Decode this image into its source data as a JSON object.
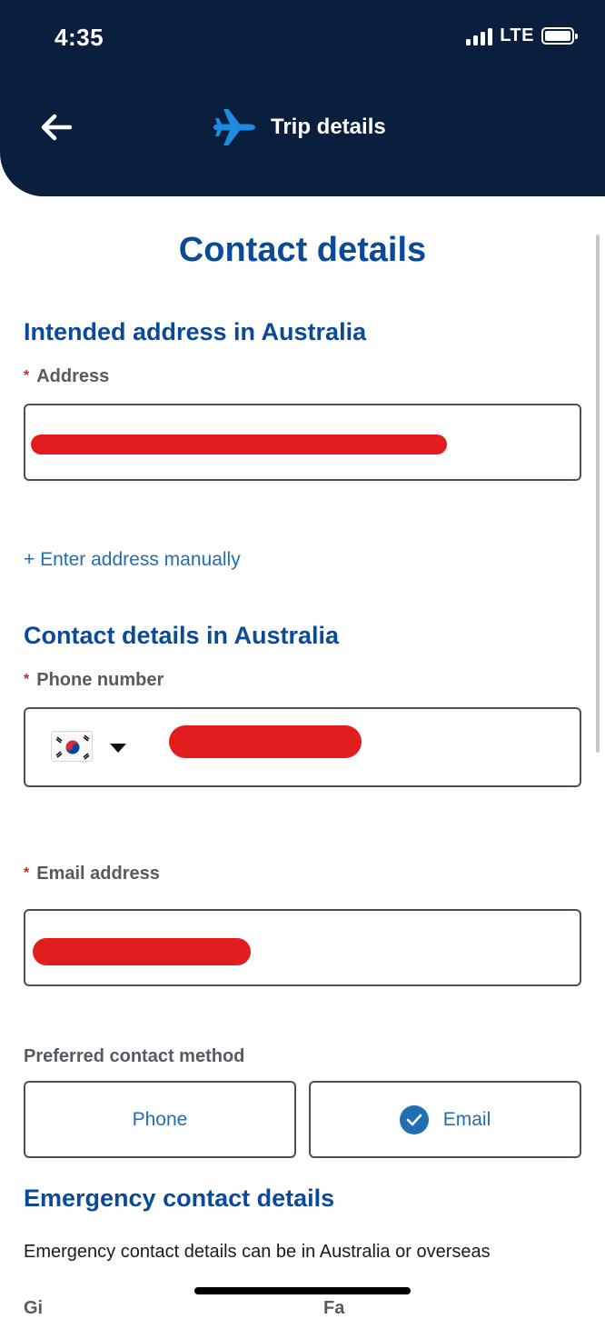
{
  "status_bar": {
    "time": "4:35",
    "network": "LTE"
  },
  "header": {
    "title": "Trip details",
    "back_icon": "arrow-left-icon",
    "plane_icon": "airplane-icon"
  },
  "page": {
    "title": "Contact details"
  },
  "address_section": {
    "heading": "Intended address in Australia",
    "address_label": "Address",
    "required_mark": "*",
    "manual_link": "+ Enter address manually"
  },
  "contact_section": {
    "heading": "Contact details in Australia",
    "phone_label": "Phone number",
    "email_label": "Email address",
    "preferred_label": "Preferred contact method",
    "options": [
      {
        "label": "Phone",
        "selected": false
      },
      {
        "label": "Email",
        "selected": true
      }
    ]
  },
  "emergency_section": {
    "heading": "Emergency contact details",
    "description": "Emergency contact details can be in Australia or overseas",
    "cut_left": "Gi",
    "cut_right": "Fa"
  },
  "colors": {
    "header_bg": "#0a1f3e",
    "heading_blue": "#0a4a97",
    "link_blue": "#1f6fb2",
    "required_red": "#d2232a",
    "redaction_red": "#e11d1d"
  }
}
